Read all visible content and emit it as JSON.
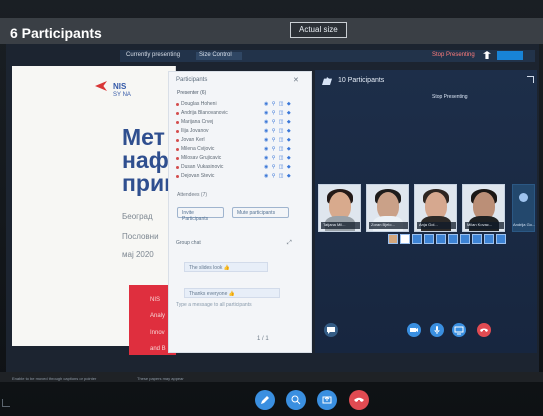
{
  "window": {
    "title": "6 Participants",
    "actual_size": "Actual size"
  },
  "share_bar": {
    "presenting_label": "Currently presenting",
    "dropdown": "Size Control",
    "stop_presenting": "Stop Presenting"
  },
  "slide": {
    "logo_text": "NIS",
    "logo_sub": "SY NA",
    "title_lines": [
      "Мет",
      "нафт",
      "прим"
    ],
    "lines": [
      "Београд",
      "Пословни",
      "мај 2020"
    ],
    "red_lines": [
      "NIS",
      "Analy",
      "Innov",
      "and B"
    ]
  },
  "panel": {
    "title": "Participants",
    "section": "Presenter (6)",
    "participants": [
      "Douglas Hoheni",
      "Andrija Blanovanovic",
      "Marijana Crvej",
      "Ilija Jovanov",
      "Jovan Kerl",
      "Milena Cvijovic",
      "Milosav Grujicavic",
      "Dusan Vukasinovic",
      "Dejovan Stevic"
    ],
    "more": "Attendees (7)",
    "invite_button": "Invite Participants",
    "mute_button": "Mute participants",
    "chat_title": "Group chat",
    "chat_messages": [
      "The slides look 👍",
      "Thanks everyone 👍"
    ],
    "chat_input": "Type a message to all participants",
    "footer": "1 / 1"
  },
  "stage": {
    "title": "10 Participants",
    "stop_presenting": "Stop Presenting",
    "video_names": [
      "Tatjana Mil...",
      "Zoran Bjelo...",
      "Anja Gol...",
      "Milan Kovac..."
    ],
    "avatar_name": "Andrija Go..."
  },
  "bottom": {
    "left_text": "Enable to be moved through captions or pointer",
    "mid_text": "These papers may appear"
  }
}
